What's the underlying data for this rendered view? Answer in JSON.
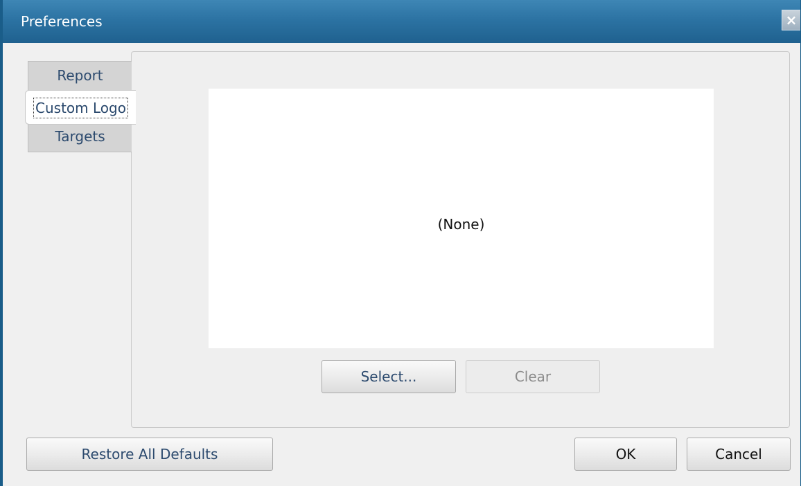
{
  "window": {
    "title": "Preferences",
    "close_glyph": "×"
  },
  "tabs": [
    {
      "label": "Report",
      "active": false
    },
    {
      "label": "Custom Logo",
      "active": true
    },
    {
      "label": "Targets",
      "active": false
    }
  ],
  "logo": {
    "preview_text": "(None)",
    "select_label": "Select...",
    "clear_label": "Clear"
  },
  "footer": {
    "restore_label": "Restore All Defaults",
    "ok_label": "OK",
    "cancel_label": "Cancel"
  },
  "colors": {
    "titlebar": "#2c73a3",
    "tab_text": "#2c4a6e"
  },
  "icons": {
    "close": "close-icon"
  }
}
